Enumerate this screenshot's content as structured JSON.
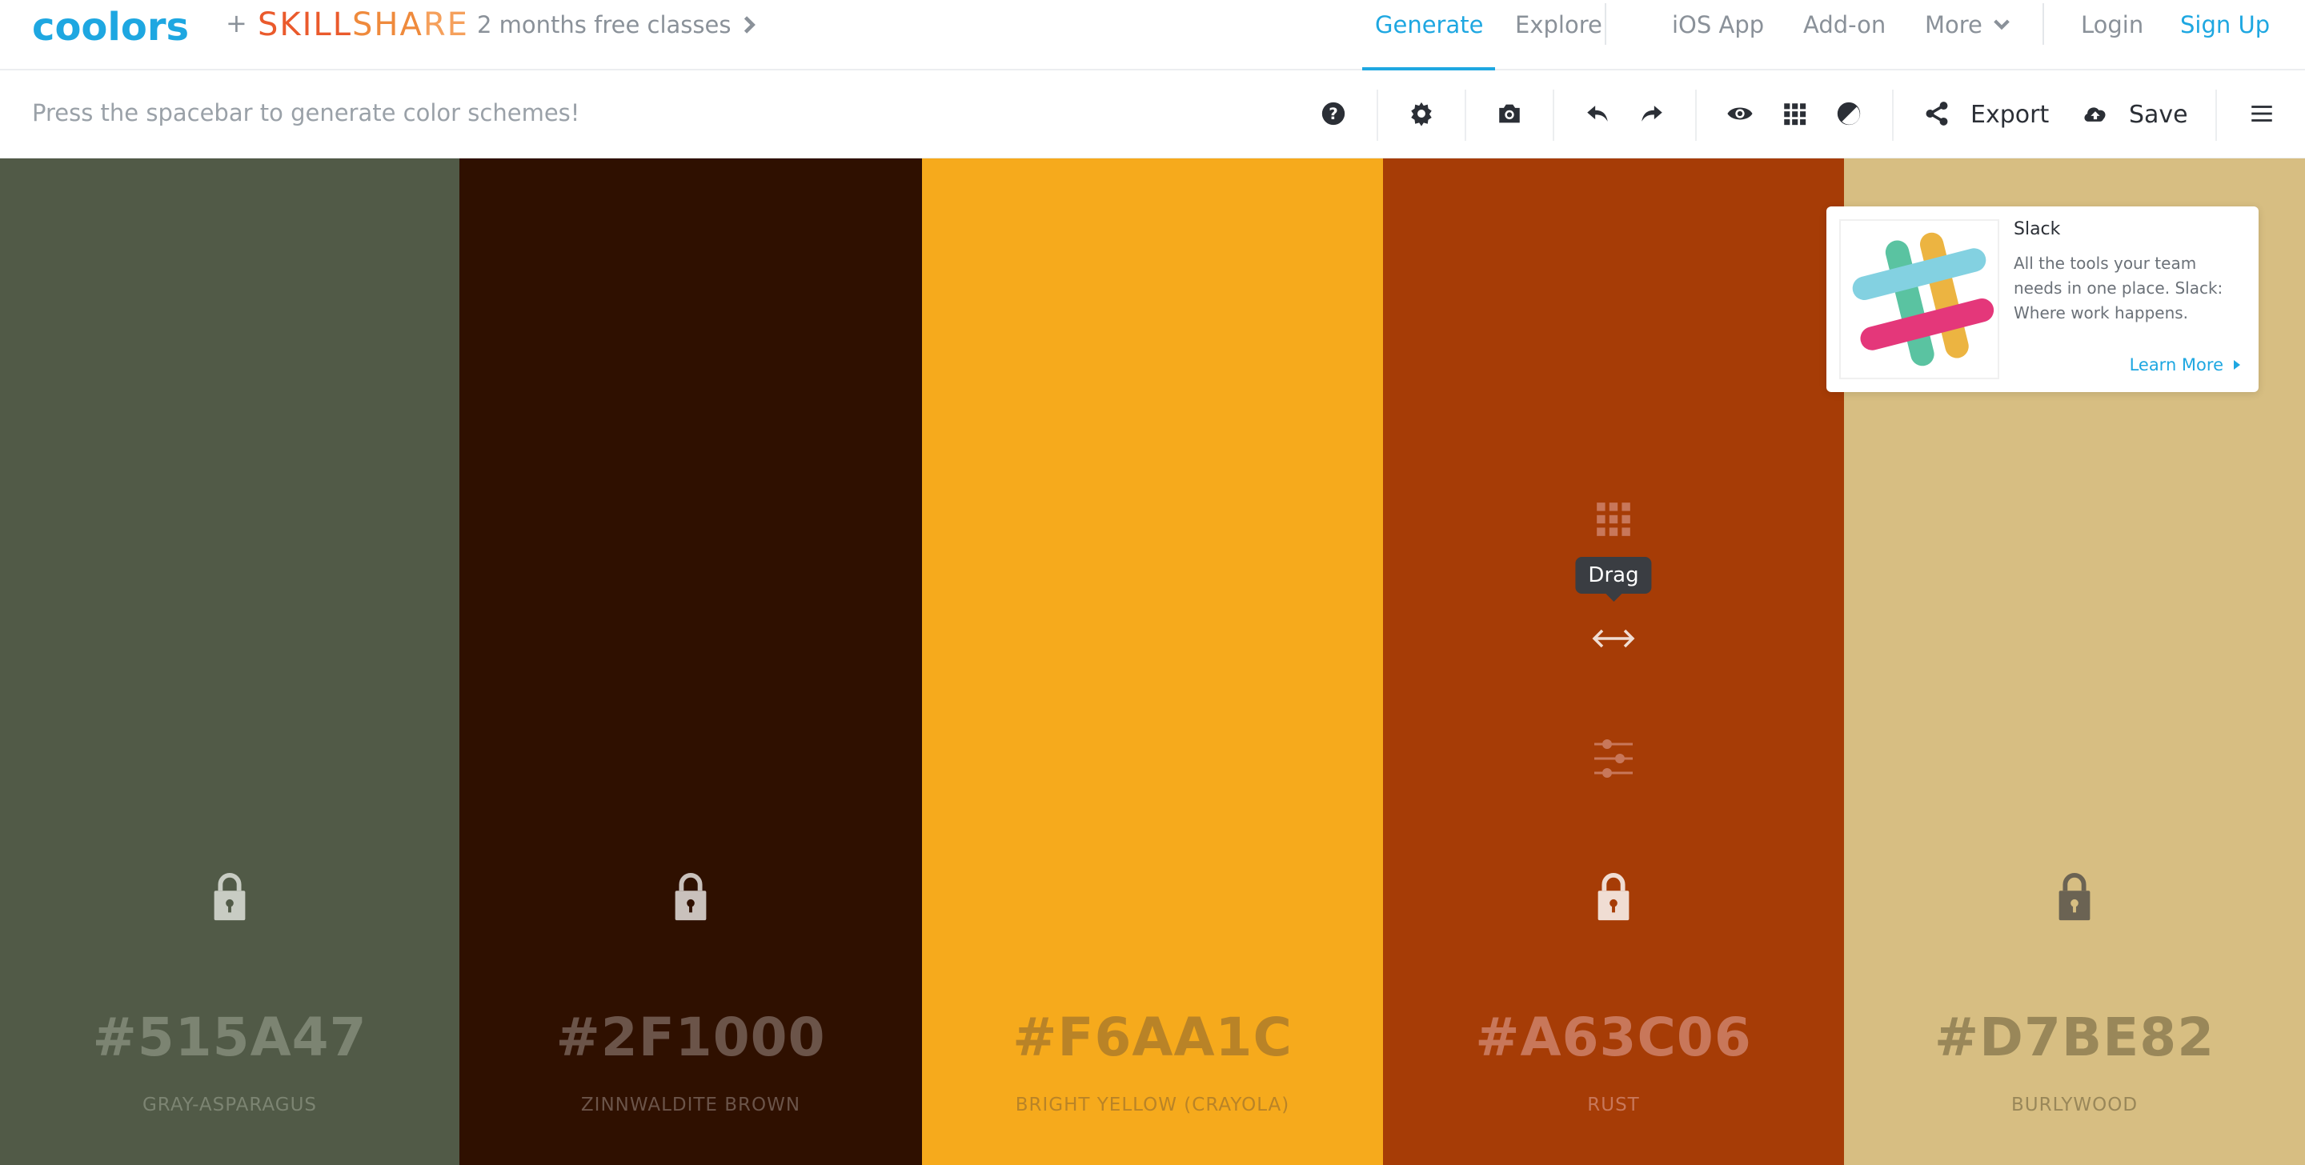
{
  "nav": {
    "logo_text": "coolors",
    "plus": "+",
    "skillshare": [
      "SKILL",
      "SHA",
      "RE"
    ],
    "promo": "2 months free classes",
    "generate": "Generate",
    "explore": "Explore",
    "ios_app": "iOS App",
    "addon": "Add-on",
    "more": "More",
    "login": "Login",
    "signup": "Sign Up",
    "accent_color": "#1ea7e1"
  },
  "toolbar": {
    "hint": "Press the spacebar to generate color schemes!",
    "export": "Export",
    "save": "Save",
    "icons": [
      "help-icon",
      "settings-icon",
      "camera-icon",
      "undo-icon",
      "redo-icon",
      "eye-icon",
      "grid-icon",
      "contrast-icon",
      "share-icon",
      "cloud-upload-icon",
      "menu-icon"
    ]
  },
  "palette": [
    {
      "hex": "#515A47",
      "name": "GRAY-ASPARAGUS",
      "bg": "#515A47",
      "fg": "#7c8472",
      "lock": "#c8ccc3"
    },
    {
      "hex": "#2F1000",
      "name": "ZINNWALDITE BROWN",
      "bg": "#2F1000",
      "fg": "#6b5449",
      "lock": "#c9c1bc"
    },
    {
      "hex": "#F6AA1C",
      "name": "BRIGHT YELLOW (CRAYOLA)",
      "bg": "#F6AA1C",
      "fg": "#b98327",
      "lock": "#f6aa1c"
    },
    {
      "hex": "#A63C06",
      "name": "RUST",
      "bg": "#A63C06",
      "fg": "#c8775a",
      "lock": "#f0ddd3"
    },
    {
      "hex": "#D7BE82",
      "name": "BURLYWOOD",
      "bg": "#D7BE82",
      "fg": "#998759",
      "lock": "#6b6353"
    }
  ],
  "column_tools": {
    "tooltip": "Drag",
    "icons": [
      "drag-grid-icon",
      "move-arrows-icon",
      "adjust-sliders-icon"
    ]
  },
  "ad": {
    "title": "Slack",
    "text": "All the tools your team needs in one place. Slack: Where work happens.",
    "link": "Learn More"
  }
}
